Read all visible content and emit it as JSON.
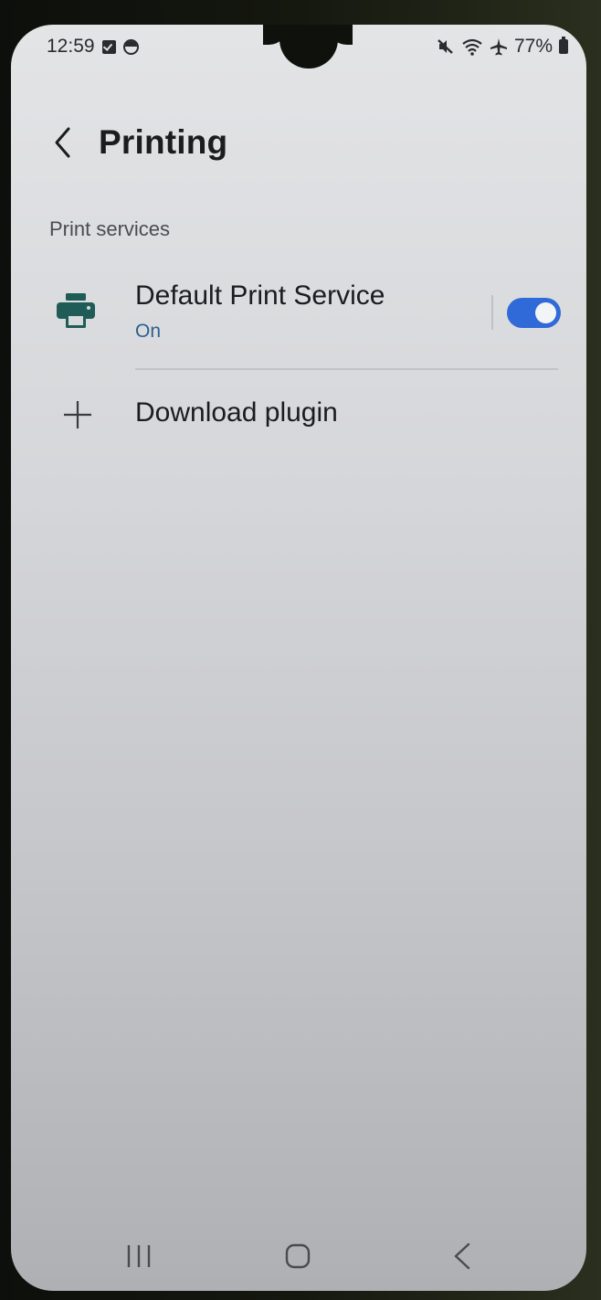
{
  "status_bar": {
    "time": "12:59",
    "battery": "77%",
    "left_icons": [
      "checkbox-notification-icon",
      "circle-notification-icon"
    ],
    "right_icons": [
      "mute-icon",
      "wifi-icon",
      "airplane-icon",
      "battery-icon"
    ]
  },
  "header": {
    "title": "Printing",
    "back_icon": "chevron-left-icon"
  },
  "section": {
    "label": "Print services"
  },
  "services": [
    {
      "title": "Default Print Service",
      "status": "On",
      "icon": "printer-icon",
      "enabled": true
    }
  ],
  "actions": {
    "download_plugin": "Download plugin",
    "download_icon": "plus-icon"
  },
  "navbar": {
    "icons": [
      "recent-apps-icon",
      "home-icon",
      "back-icon"
    ]
  },
  "colors": {
    "accent": "#2f6ad8",
    "printer_icon": "#1f5c57",
    "subtitle": "#2f5f8f"
  }
}
